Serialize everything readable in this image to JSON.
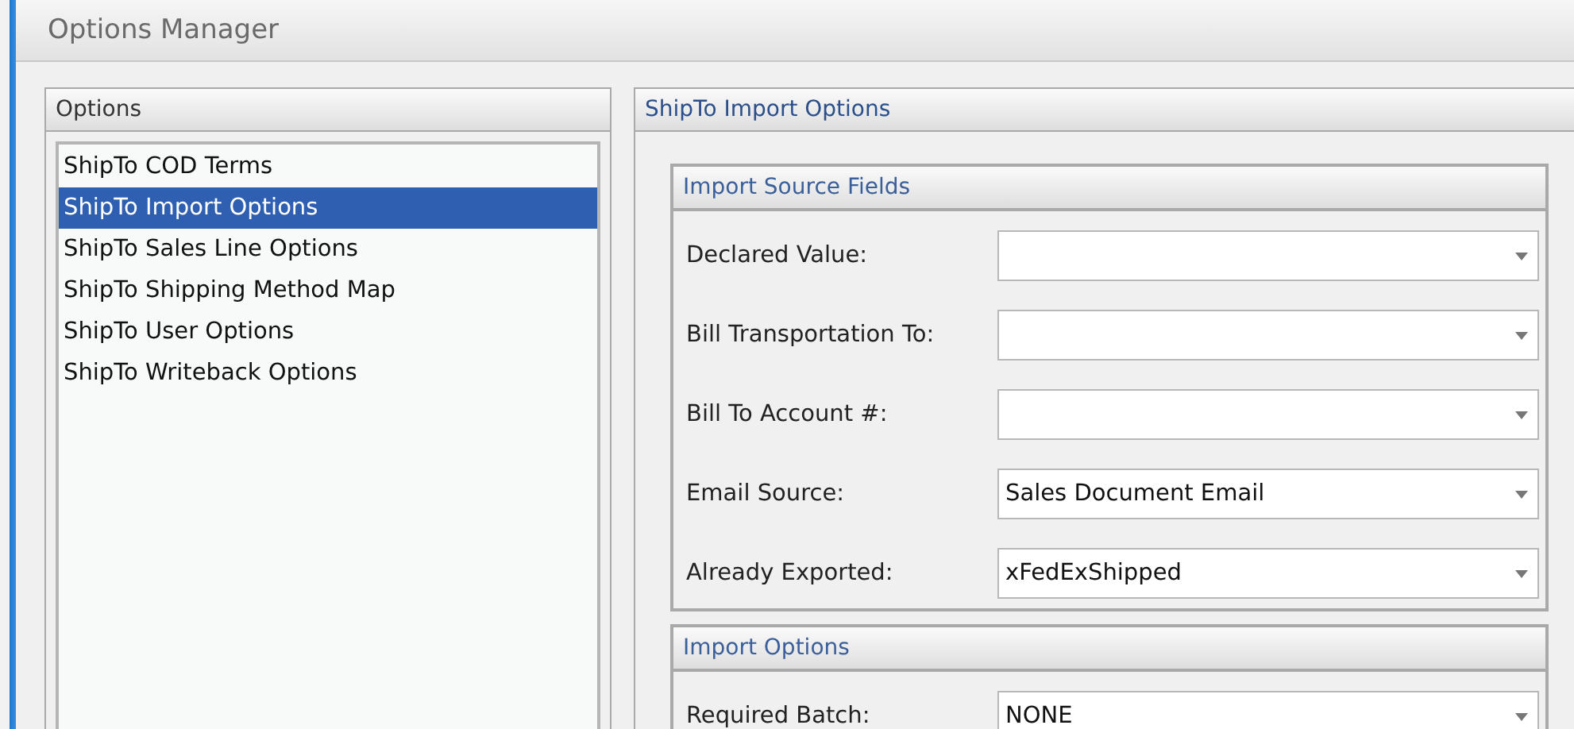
{
  "window": {
    "title": "Options Manager"
  },
  "options_panel": {
    "title": "Options",
    "items": [
      {
        "label": "ShipTo COD Terms",
        "selected": false
      },
      {
        "label": "ShipTo Import Options",
        "selected": true
      },
      {
        "label": "ShipTo Sales Line Options",
        "selected": false
      },
      {
        "label": "ShipTo Shipping Method Map",
        "selected": false
      },
      {
        "label": "ShipTo User Options",
        "selected": false
      },
      {
        "label": "ShipTo Writeback Options",
        "selected": false
      }
    ]
  },
  "detail_panel": {
    "title": "ShipTo Import Options",
    "groups": [
      {
        "title": "Import Source Fields",
        "fields": [
          {
            "label": "Declared Value:"
          },
          {
            "label": "Bill Transportation To:"
          },
          {
            "label": "Bill To Account #:"
          },
          {
            "label": "Email Source:",
            "value": "Sales Document Email"
          },
          {
            "label": "Already Exported:",
            "value": "xFedExShipped"
          }
        ]
      },
      {
        "title": "Import Options",
        "fields": [
          {
            "label": "Required Batch:",
            "value": "NONE"
          }
        ]
      }
    ]
  }
}
